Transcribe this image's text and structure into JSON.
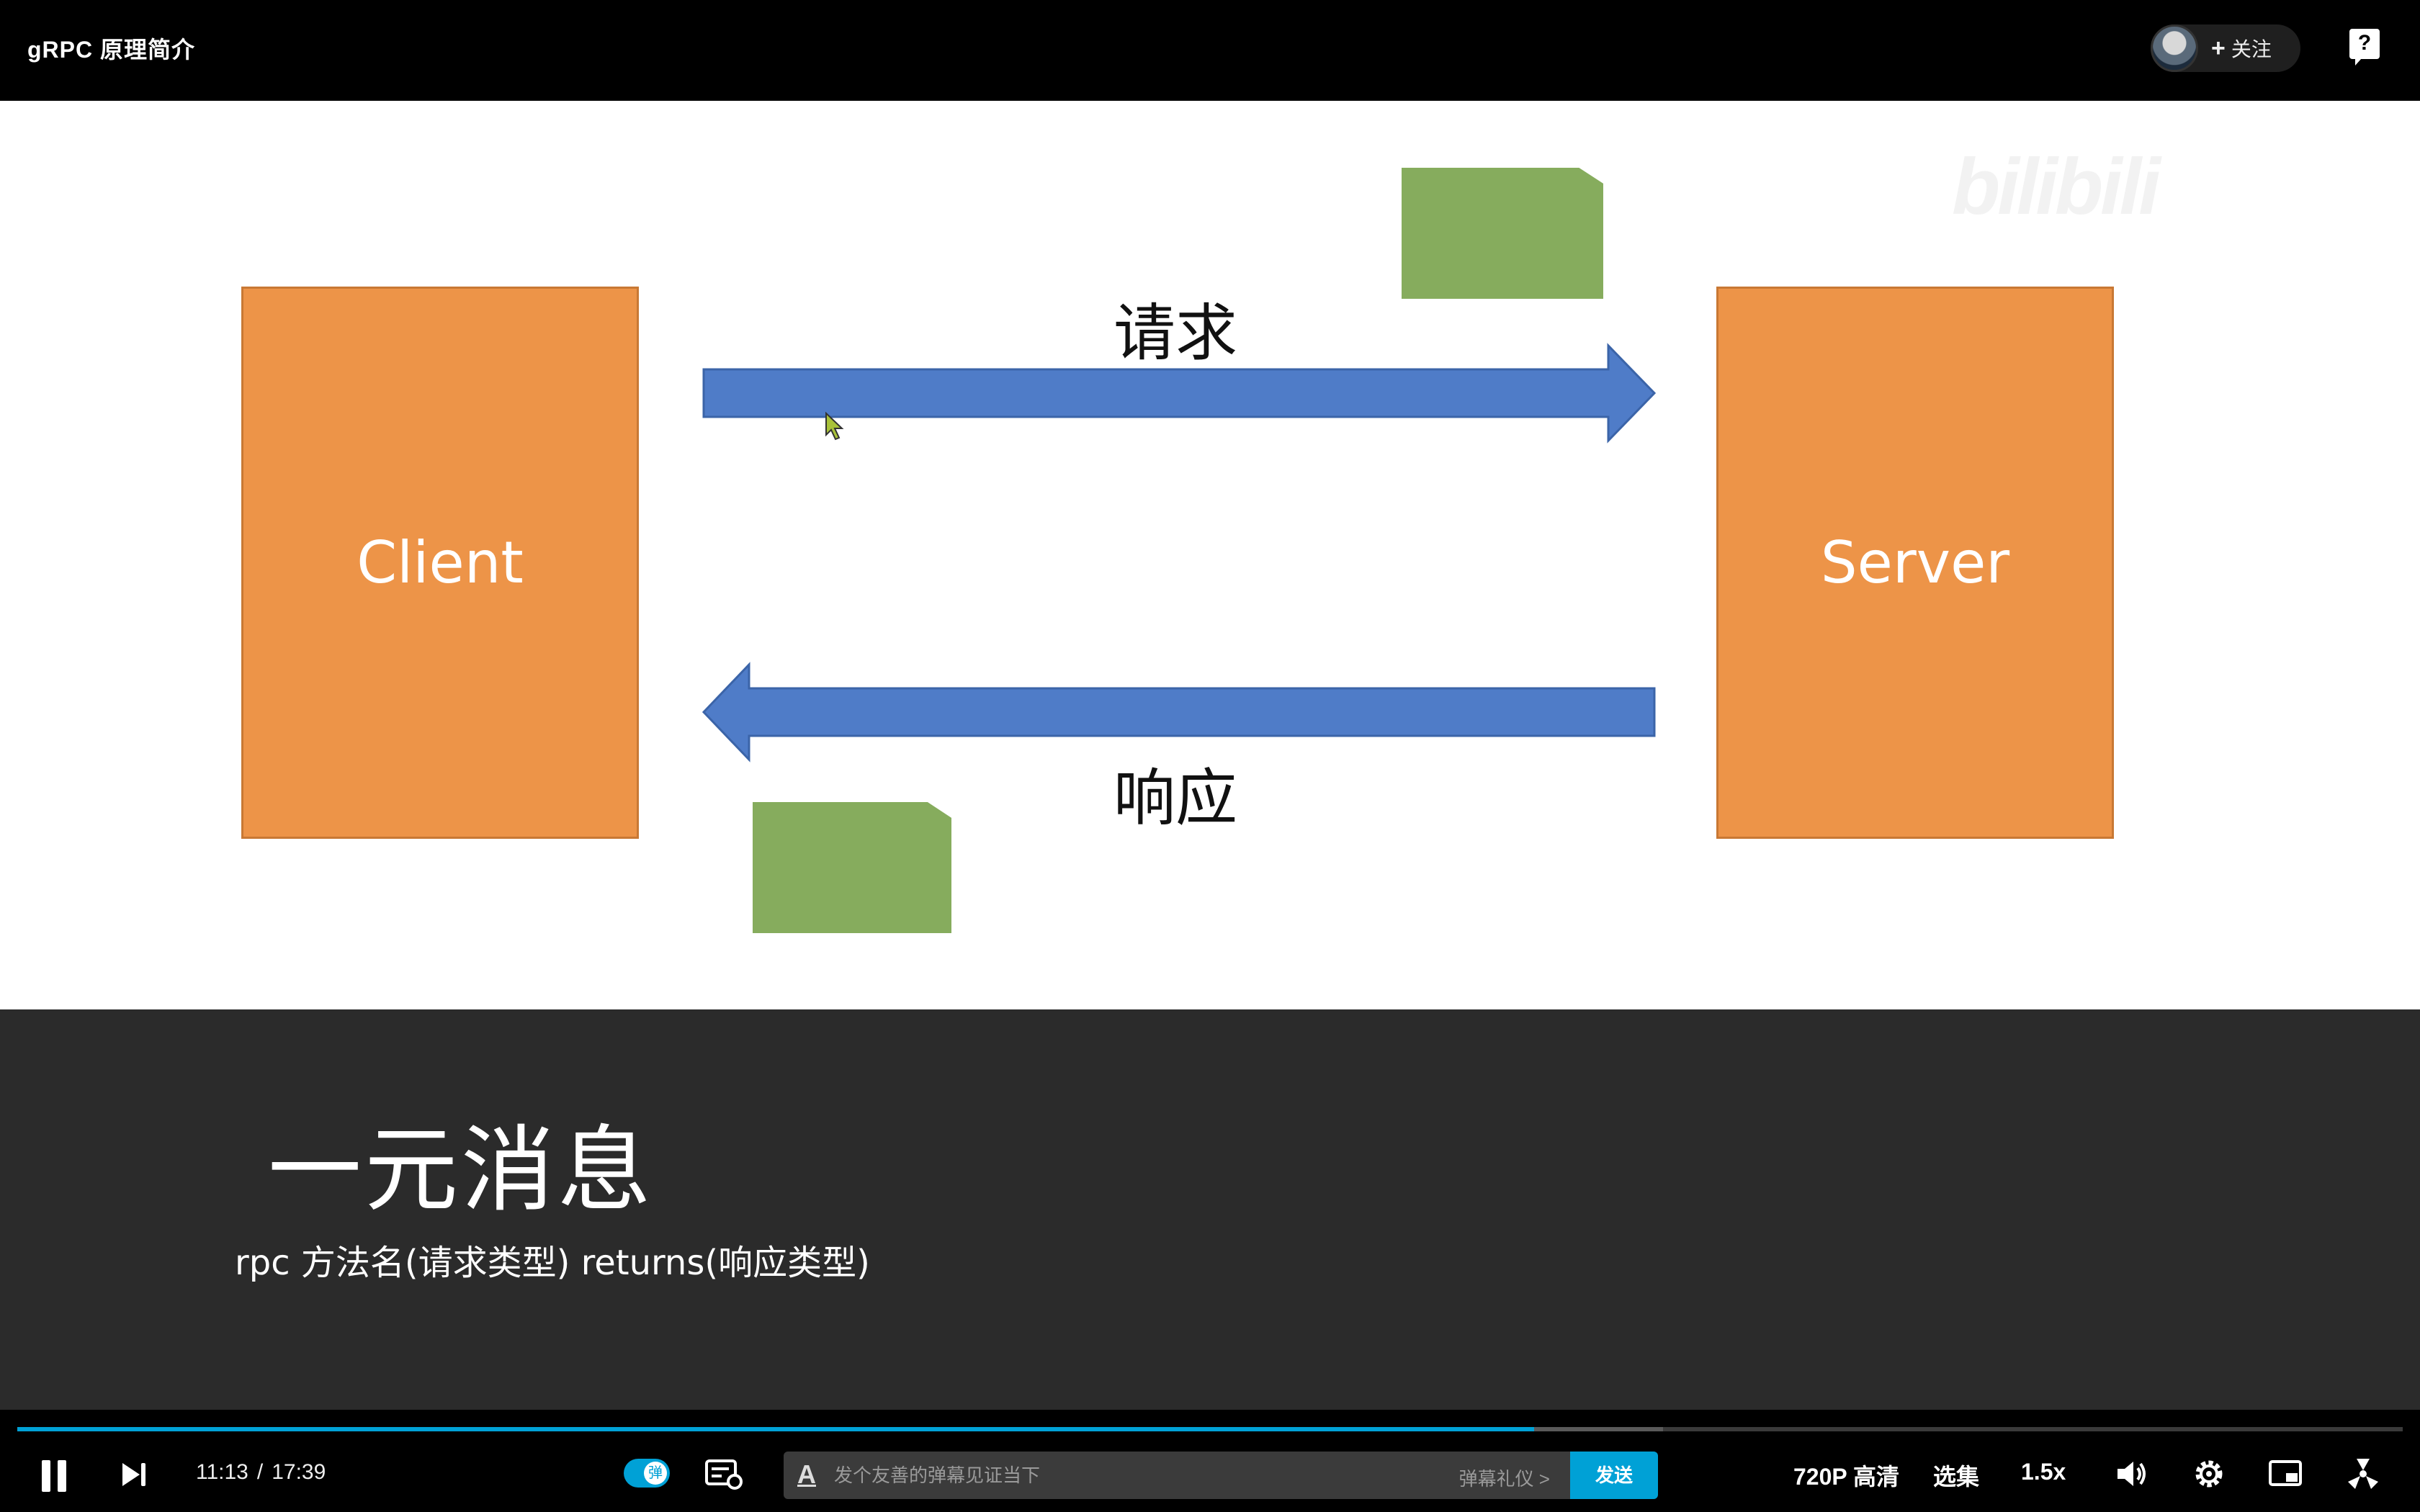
{
  "header": {
    "title": "gRPC 原理简介",
    "follow_label": "关注"
  },
  "slide": {
    "client_label": "Client",
    "server_label": "Server",
    "request_label": "请求",
    "response_label": "响应",
    "watermark": "bilibili",
    "box_color": "#ed9448",
    "arrow_color": "#4f7cc8",
    "message_color": "#86ac5d"
  },
  "lower_panel": {
    "heading": "一元消息",
    "syntax": "rpc 方法名(请求类型) returns(响应类型)"
  },
  "player": {
    "current_time": "11:13",
    "separator": "/",
    "total_time": "17:39",
    "progress": 0.636,
    "buffered": 0.69,
    "danmaku_toggle_label": "弹",
    "danmaku_placeholder": "发个友善的弹幕见证当下",
    "danmaku_etiquette": "弹幕礼仪 >",
    "send_label": "发送",
    "quality": "720P 高清",
    "episodes": "选集",
    "speed": "1.5x",
    "accent_color": "#00a1d6"
  }
}
